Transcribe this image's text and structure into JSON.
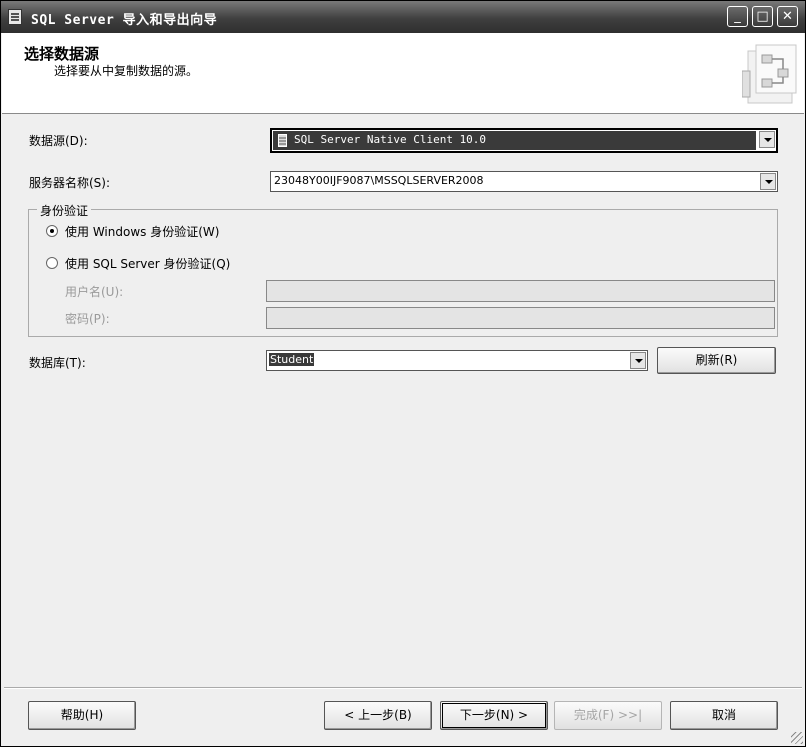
{
  "window": {
    "title": "SQL Server 导入和导出向导",
    "icon": "wizard-app-icon",
    "controls": {
      "minimize": "_",
      "maximize": "□",
      "close": "✕"
    }
  },
  "header": {
    "title": "选择数据源",
    "subtitle": "选择要从中复制数据的源。",
    "graphic_icon": "data-flow-icon"
  },
  "form": {
    "data_source": {
      "label": "数据源(D):",
      "value": "SQL Server Native Client 10.0",
      "icon": "database-icon"
    },
    "server_name": {
      "label": "服务器名称(S):",
      "value": "23048Y00IJF9087\\MSSQLSERVER2008"
    },
    "auth": {
      "group_label": "身份验证",
      "windows_option": "使用 Windows 身份验证(W)",
      "sql_option": "使用 SQL Server 身份验证(Q)",
      "selected": "windows",
      "username_label": "用户名(U):",
      "password_label": "密码(P):",
      "username_value": "",
      "password_value": ""
    },
    "database": {
      "label": "数据库(T):",
      "value": "Student"
    },
    "refresh_button": "刷新(R)"
  },
  "footer": {
    "help": "帮助(H)",
    "back": "< 上一步(B)",
    "next": "下一步(N) >",
    "finish": "完成(F) >>|",
    "cancel": "取消"
  }
}
